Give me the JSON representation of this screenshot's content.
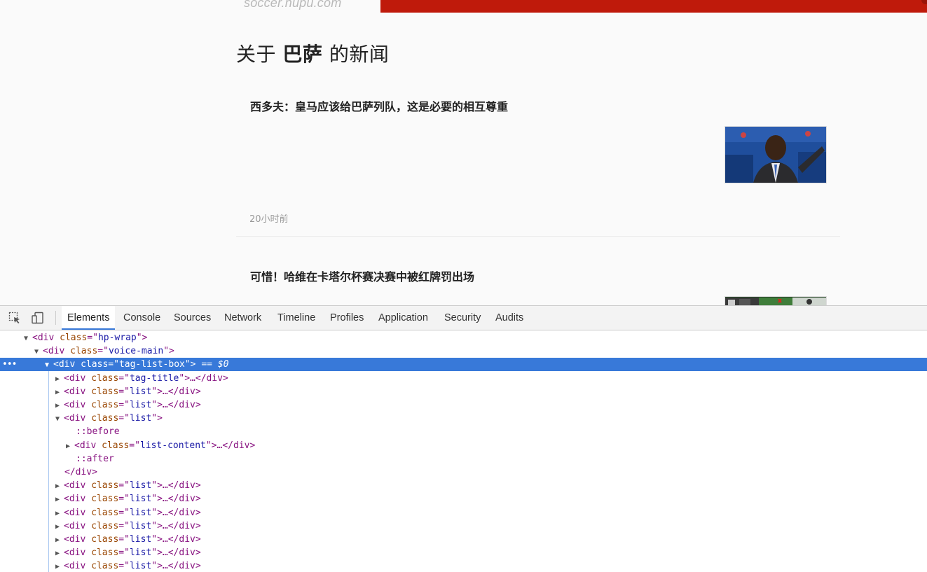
{
  "page": {
    "site_logo": "soccer.hupu.com",
    "tag_title": {
      "prefix": "关于",
      "tag": "巴萨",
      "suffix": "的新闻"
    },
    "news": [
      {
        "title": "西多夫：皇马应该给巴萨列队，这是必要的相互尊重",
        "time": "20小时前",
        "thumb_icon": "news-photo-seedorf"
      },
      {
        "title": "可惜！哈维在卡塔尔杯赛决赛中被红牌罚出场",
        "thumb_icon": "news-photo-match"
      }
    ],
    "colors": {
      "brand_red": "#bf1a0b",
      "devtools_accent": "#3879d9"
    }
  },
  "devtools": {
    "tools": [
      {
        "name": "inspect-element-icon"
      },
      {
        "name": "device-mode-icon"
      }
    ],
    "tabs": [
      {
        "label": "Elements",
        "active": true
      },
      {
        "label": "Console"
      },
      {
        "label": "Sources"
      },
      {
        "label": "Network"
      },
      {
        "label": "Timeline"
      },
      {
        "label": "Profiles"
      },
      {
        "label": "Application"
      },
      {
        "label": "Security"
      },
      {
        "label": "Audits"
      }
    ],
    "tree": [
      {
        "kind": "open",
        "tri": "down",
        "tag": "div",
        "attr": "class",
        "val": "hp-wrap"
      },
      {
        "kind": "open",
        "tri": "down",
        "tag": "div",
        "attr": "class",
        "val": "voice-main"
      },
      {
        "kind": "open",
        "tri": "down",
        "tag": "div",
        "attr": "class",
        "val": "tag-list-box",
        "selected": true,
        "suffix": " == $0"
      },
      {
        "kind": "collapsed",
        "tri": "right",
        "tag": "div",
        "attr": "class",
        "val": "tag-title"
      },
      {
        "kind": "collapsed",
        "tri": "right",
        "tag": "div",
        "attr": "class",
        "val": "list"
      },
      {
        "kind": "collapsed",
        "tri": "right",
        "tag": "div",
        "attr": "class",
        "val": "list"
      },
      {
        "kind": "open",
        "tri": "down",
        "tag": "div",
        "attr": "class",
        "val": "list"
      },
      {
        "kind": "pseudo",
        "text": "::before"
      },
      {
        "kind": "collapsed",
        "tri": "right",
        "tag": "div",
        "attr": "class",
        "val": "list-content"
      },
      {
        "kind": "pseudo",
        "text": "::after"
      },
      {
        "kind": "close",
        "tag": "div"
      },
      {
        "kind": "collapsed",
        "tri": "right",
        "tag": "div",
        "attr": "class",
        "val": "list"
      },
      {
        "kind": "collapsed",
        "tri": "right",
        "tag": "div",
        "attr": "class",
        "val": "list"
      },
      {
        "kind": "collapsed",
        "tri": "right",
        "tag": "div",
        "attr": "class",
        "val": "list"
      },
      {
        "kind": "collapsed",
        "tri": "right",
        "tag": "div",
        "attr": "class",
        "val": "list"
      },
      {
        "kind": "collapsed",
        "tri": "right",
        "tag": "div",
        "attr": "class",
        "val": "list"
      },
      {
        "kind": "collapsed",
        "tri": "right",
        "tag": "div",
        "attr": "class",
        "val": "list"
      },
      {
        "kind": "collapsed",
        "tri": "right",
        "tag": "div",
        "attr": "class",
        "val": "list"
      }
    ]
  }
}
